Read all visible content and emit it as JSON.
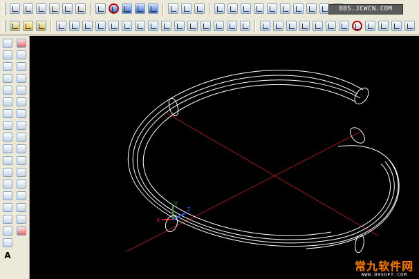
{
  "toolbar_top": {
    "watermark": "BBS.JCWCN.COM",
    "row1_icons": [
      "box-icon",
      "sphere-icon",
      "cylinder-icon",
      "cone-icon",
      "wedge-icon",
      "torus-icon",
      "extrude-icon",
      "revolve-icon",
      "slice-icon",
      "section-icon",
      "interfere-icon",
      "setup-drawing-icon",
      "setup-view-icon",
      "setup-profile-icon",
      "view-top-icon",
      "view-bottom-icon",
      "view-left-icon",
      "view-right-icon",
      "view-front-icon",
      "view-back-icon",
      "view-sw-iso-icon",
      "view-se-iso-icon",
      "view-ne-iso-icon",
      "view-nw-iso-icon"
    ],
    "row2_icons": [
      "solid-union-icon",
      "solid-subtract-icon",
      "solid-intersect-icon",
      "extrude-faces-icon",
      "move-faces-icon",
      "offset-faces-icon",
      "delete-faces-icon",
      "rotate-faces-icon",
      "taper-faces-icon",
      "copy-faces-icon",
      "color-faces-icon",
      "copy-edges-icon",
      "color-edges-icon",
      "imprint-icon",
      "clean-icon",
      "separate-icon",
      "shell-icon",
      "check-icon",
      "ucs-icon",
      "ucs-world-icon",
      "ucs-previous-icon",
      "ucs-face-icon",
      "ucs-object-icon",
      "ucs-view-icon",
      "ucs-origin-icon",
      "ucs-zaxis-icon",
      "ucs-3point-icon",
      "ucs-x-icon",
      "ucs-y-icon",
      "ucs-z-icon",
      "ucs-apply-icon"
    ]
  },
  "left_toolbar": {
    "tools": [
      "line-icon",
      "construction-line-icon",
      "polyline-icon",
      "polygon-icon",
      "rectangle-icon",
      "arc-icon",
      "circle-icon",
      "revision-cloud-icon",
      "spline-icon",
      "ellipse-icon",
      "ellipse-arc-icon",
      "insert-block-icon",
      "make-block-icon",
      "point-icon",
      "hatch-icon",
      "gradient-icon",
      "region-icon",
      "table-icon",
      "multiline-text-icon",
      "erase-icon",
      "copy-icon",
      "mirror-icon",
      "offset-icon",
      "array-icon",
      "move-icon",
      "rotate-icon",
      "scale-icon",
      "stretch-icon",
      "trim-icon",
      "extend-icon",
      "break-at-point-icon",
      "break-icon",
      "join-icon",
      "chamfer-icon",
      "fillet-icon",
      "explode-icon"
    ],
    "text_tool_label": "A"
  },
  "viewport": {
    "background": "#000000",
    "axis_color": "#b02020",
    "wire_color": "#ffffff",
    "ucs_labels": {
      "x": "X",
      "y": "Y",
      "z": "Z"
    }
  },
  "brand": {
    "title": "常九软件网",
    "subtitle": "WWW.D9SOFT.COM"
  }
}
